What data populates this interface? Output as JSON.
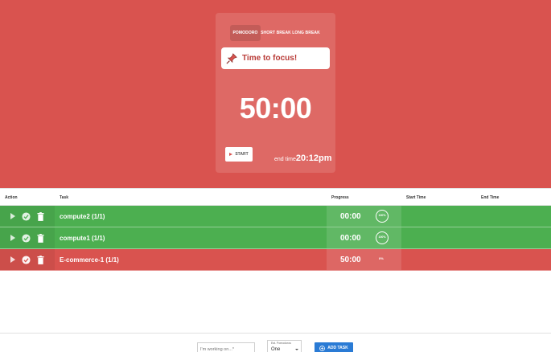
{
  "tabs": {
    "pomodoro": "POMODORO",
    "short_break": "SHORT BREAK",
    "long_break": "LONG BREAK",
    "active": "pomodoro"
  },
  "focus": {
    "text": "Time to focus!",
    "icon": "pushpin-icon"
  },
  "timer": {
    "display": "50:00"
  },
  "controls": {
    "start_label": "START",
    "end_time_label": "end time",
    "end_time_value": "20:12pm"
  },
  "table": {
    "headers": {
      "action": "Action",
      "task": "Task",
      "progress": "Progress",
      "start_time": "Start Time",
      "end_time": "End Time"
    },
    "rows": [
      {
        "name": "compute2 (1/1)",
        "time": "00:00",
        "percent": "100%",
        "status": "done",
        "color": "#4caf50"
      },
      {
        "name": "compute1 (1/1)",
        "time": "00:00",
        "percent": "100%",
        "status": "done",
        "color": "#4caf50"
      },
      {
        "name": "E-commerce-1 (1/1)",
        "time": "50:00",
        "percent": "0%",
        "status": "active",
        "color": "#d9534f"
      }
    ]
  },
  "footer": {
    "task_placeholder": "I'm working on...*",
    "est_label": "Est. Pomodoros",
    "est_value": "One",
    "add_button_label": "ADD TASK"
  },
  "colors": {
    "accent_red": "#d9534f",
    "done_green": "#4caf50",
    "button_blue": "#2a7bd5"
  }
}
